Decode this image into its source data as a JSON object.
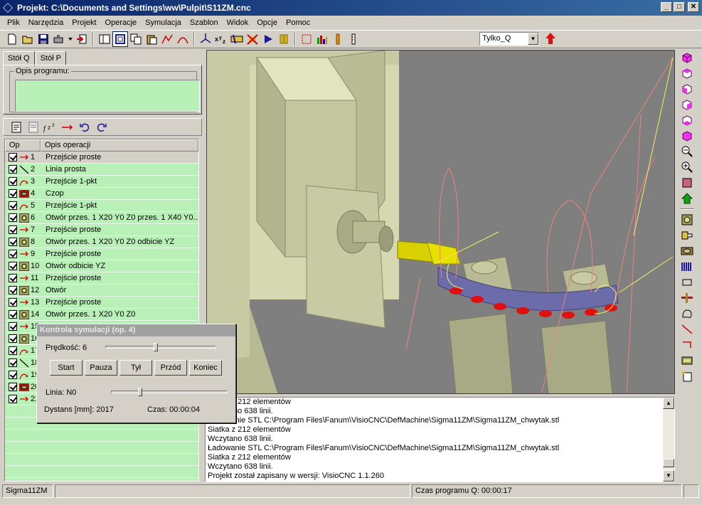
{
  "window": {
    "title": "Projekt: C:\\Documents and Settings\\ww\\Pulpit\\S11ZM.cnc",
    "minimize": "_",
    "maximize": "□",
    "close": "✕"
  },
  "menu": [
    "Plik",
    "Narzędzia",
    "Projekt",
    "Operacje",
    "Symulacja",
    "Szablon",
    "Widok",
    "Opcje",
    "Pomoc"
  ],
  "toolbar": {
    "combo_value": "Tylko_Q",
    "combo_arrow": "▼"
  },
  "tabs": [
    "Stół Q",
    "Stół P"
  ],
  "program": {
    "legend": "Opis programu:",
    "value": ""
  },
  "grid": {
    "headers": [
      "Op",
      "Opis operacji"
    ],
    "rows": [
      {
        "num": "1",
        "desc": "Przejście proste",
        "icon": "arrow-line-icon"
      },
      {
        "num": "2",
        "desc": "Linia prosta",
        "icon": "diagonal-line-icon"
      },
      {
        "num": "3",
        "desc": "Przejście 1-pkt",
        "icon": "arc-arrow-icon"
      },
      {
        "num": "4",
        "desc": "Czop",
        "icon": "pin-icon"
      },
      {
        "num": "5",
        "desc": "Przejście 1-pkt",
        "icon": "arc-arrow-icon"
      },
      {
        "num": "6",
        "desc": "Otwór przes. 1 X20 Y0 Z0 przes. 1 X40 Y0...",
        "icon": "hole-icon"
      },
      {
        "num": "7",
        "desc": "Przejście proste",
        "icon": "arrow-line-icon"
      },
      {
        "num": "8",
        "desc": "Otwór przes. 1 X20 Y0 Z0 odbicie YZ",
        "icon": "hole-icon"
      },
      {
        "num": "9",
        "desc": "Przejście proste",
        "icon": "arrow-line-icon"
      },
      {
        "num": "10",
        "desc": "Otwór odbicie YZ",
        "icon": "hole-icon"
      },
      {
        "num": "11",
        "desc": "Przejście proste",
        "icon": "arrow-line-icon"
      },
      {
        "num": "12",
        "desc": "Otwór",
        "icon": "hole-icon"
      },
      {
        "num": "13",
        "desc": "Przejście proste",
        "icon": "arrow-line-icon"
      },
      {
        "num": "14",
        "desc": "Otwór przes. 1 X20 Y0 Z0",
        "icon": "hole-icon"
      },
      {
        "num": "15",
        "desc": "",
        "icon": "arrow-line-icon"
      },
      {
        "num": "16",
        "desc": "",
        "icon": "hole-icon"
      },
      {
        "num": "17",
        "desc": "",
        "icon": "arc-arrow-icon"
      },
      {
        "num": "18",
        "desc": "",
        "icon": "diagonal-line-icon"
      },
      {
        "num": "19",
        "desc": "",
        "icon": "arc-arrow-icon"
      },
      {
        "num": "20",
        "desc": "",
        "icon": "pin-icon"
      },
      {
        "num": "21",
        "desc": "",
        "icon": "arrow-line-icon"
      }
    ]
  },
  "log": {
    "lines": [
      "Siatka z 212 elementów",
      "Wczytano 638 linii.",
      "Ładowanie STL C:\\Program Files\\Fanum\\VisioCNC\\DefMachine\\Sigma11ZM\\Sigma11ZM_chwytak.stl",
      "Siatka z 212 elementów",
      "Wczytano 638 linii.",
      "Ładowanie STL C:\\Program Files\\Fanum\\VisioCNC\\DefMachine\\Sigma11ZM\\Sigma11ZM_chwytak.stl",
      "Siatka z 212 elementów",
      "Wczytano 638 linii.",
      "Projekt został zapisany w wersji: VisioCNC 1.1.260"
    ],
    "scroll_up": "▲",
    "scroll_down": "▼"
  },
  "status": {
    "machine": "Sigma11ZM",
    "program_time": "Czas programu Q: 00:00:17"
  },
  "dialog": {
    "title": "Kontrola symulacji (op. 4)",
    "speed_label": "Prędkość: 6",
    "speed_value": 0.45,
    "buttons": [
      "Start",
      "Pauza",
      "Tył",
      "Przód",
      "Koniec"
    ],
    "line_label": "Linia: N0",
    "line_value": 0.24,
    "distance": "Dystans [mm]: 2017",
    "time": "Czas: 00:00:04"
  },
  "colors": {
    "titlebar_start": "#0a246a",
    "titlebar_end": "#3a6ea5",
    "grid_bg": "#b8f0b8",
    "machine_body": "#c8caa4",
    "workpiece": "#6c6caa",
    "marker_red": "#e01010"
  }
}
